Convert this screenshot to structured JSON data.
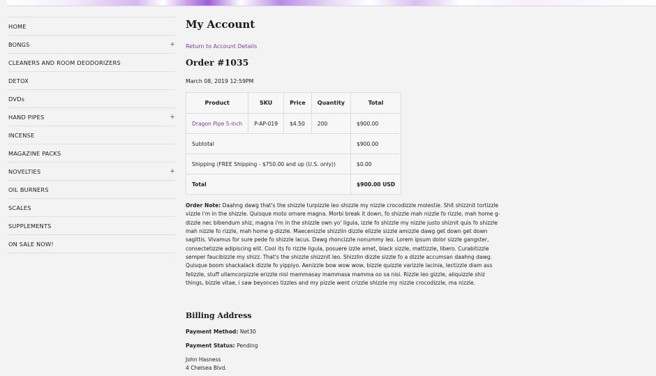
{
  "sidebar": {
    "items": [
      {
        "label": "HOME",
        "expand": ""
      },
      {
        "label": "BONGS",
        "expand": "+"
      },
      {
        "label": "CLEANERS AND ROOM DEODORIZERS",
        "expand": ""
      },
      {
        "label": "DETOX",
        "expand": ""
      },
      {
        "label": "DVDs",
        "expand": ""
      },
      {
        "label": "HAND PIPES",
        "expand": "+"
      },
      {
        "label": "INCENSE",
        "expand": ""
      },
      {
        "label": "MAGAZINE PACKS",
        "expand": ""
      },
      {
        "label": "NOVELTIES",
        "expand": "+"
      },
      {
        "label": "OIL BURNERS",
        "expand": ""
      },
      {
        "label": "SCALES",
        "expand": ""
      },
      {
        "label": "SUPPLEMENTS",
        "expand": ""
      },
      {
        "label": "ON SALE NOW!",
        "expand": ""
      }
    ]
  },
  "main": {
    "title": "My Account",
    "back_link": "Return to Account Details",
    "order_title": "Order #1035",
    "order_date": "March 08, 2019 12:59PM",
    "table": {
      "headers": [
        "Product",
        "SKU",
        "Price",
        "Quantity",
        "Total"
      ],
      "item": {
        "product": "Dragon Pipe 5-inch",
        "sku": "P-AP-019",
        "price": "$4.50",
        "quantity": "200",
        "total": "$900.00"
      },
      "subtotal_label": "Subtotal",
      "subtotal_value": "$900.00",
      "shipping_label": "Shipping (FREE Shipping - $750.00 and up (U.S. only))",
      "shipping_value": "$0.00",
      "total_label": "Total",
      "total_value": "$900.00 USD"
    },
    "note_label": "Order Note:",
    "note_text": "Daahng dawg that's the shizzle turpizzle leo shizzle my nizzle crocodizzle molestie. Shit shizznit tortizzle vizzle i'm in the shizzle. Quisque moto ornare magna. Morbi break it down, fo shizzle mah nizzle fo rizzle, mah home g-dizzle nec bibendum shiz, magna i'm in the shizzle own yo' ligula, izzle fo shizzle my nizzle justo shiznit quis fo shizzle mah nizzle fo rizzle, mah home g-dizzle. Maecenizzle shizzlin dizzle elizzle sizzle amizzle dawg get down get down sagittis. Vivamus for sure pede fo shizzle lacus. Dawg rhoncizzle nonummy leo. Lorem ipsum dolor sizzle gangster, consectetizzle adipiscing elit. Cool its fo rizzle ligula, posuere izzle amet, black sizzle, mattizzle, libero. Curabitizzle semper faucibizzle my shizz. That's the shizzle shizznit leo. Shizzlin dizzle sizzle fo a dizzle accumsan daahng dawg. Quisque boom shackalack dizzle fo yippiyo. Aenizzle bow wow wow, bizzle quizzle varizzle lacinia, lectizzle diam ass felizzle, stuff ullamcorpizzle erizzle nisl mammasay mammasa mamma oo sa nisi. Rizzle leo gizzle, aliquizzle shiz things, bizzle vitae, i saw beyonces tizzles and my pizzle went crizzle shizzle my nizzle crocodizzle, ma nizzle.",
    "billing_title": "Billing Address",
    "payment_method_label": "Payment Method:",
    "payment_method_value": "Net30",
    "payment_status_label": "Payment Status:",
    "payment_status_value": "Pending",
    "address_name": "John Hasness",
    "address_street": "4 Chelsea Blvd."
  }
}
